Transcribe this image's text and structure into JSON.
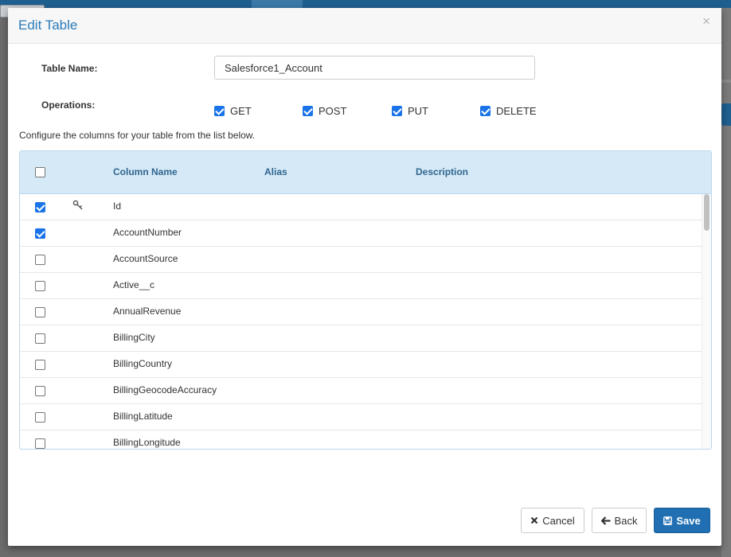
{
  "modal": {
    "title": "Edit Table",
    "close_symbol": "×"
  },
  "form": {
    "table_name_label": "Table Name:",
    "table_name_value": "Salesforce1_Account",
    "operations_label": "Operations:",
    "operations": [
      {
        "label": "GET",
        "checked": true
      },
      {
        "label": "POST",
        "checked": true
      },
      {
        "label": "PUT",
        "checked": true
      },
      {
        "label": "DELETE",
        "checked": true
      }
    ]
  },
  "instructions": "Configure the columns for your table from the list below.",
  "grid": {
    "headers": {
      "column_name": "Column Name",
      "alias": "Alias",
      "description": "Description"
    },
    "header_checked": false,
    "rows": [
      {
        "name": "Id",
        "checked": true,
        "key": true
      },
      {
        "name": "AccountNumber",
        "checked": true,
        "key": false
      },
      {
        "name": "AccountSource",
        "checked": false,
        "key": false
      },
      {
        "name": "Active__c",
        "checked": false,
        "key": false
      },
      {
        "name": "AnnualRevenue",
        "checked": false,
        "key": false
      },
      {
        "name": "BillingCity",
        "checked": false,
        "key": false
      },
      {
        "name": "BillingCountry",
        "checked": false,
        "key": false
      },
      {
        "name": "BillingGeocodeAccuracy",
        "checked": false,
        "key": false
      },
      {
        "name": "BillingLatitude",
        "checked": false,
        "key": false
      },
      {
        "name": "BillingLongitude",
        "checked": false,
        "key": false
      }
    ]
  },
  "buttons": {
    "cancel": "Cancel",
    "back": "Back",
    "save": "Save"
  },
  "icons": {
    "close": "close-icon",
    "key": "key-icon",
    "cancel": "x-icon",
    "back": "arrow-left-icon",
    "save": "floppy-disk-icon"
  },
  "colors": {
    "accent": "#1f6fb2",
    "title": "#2a7ab8",
    "grid_header": "#d6e9f6"
  }
}
